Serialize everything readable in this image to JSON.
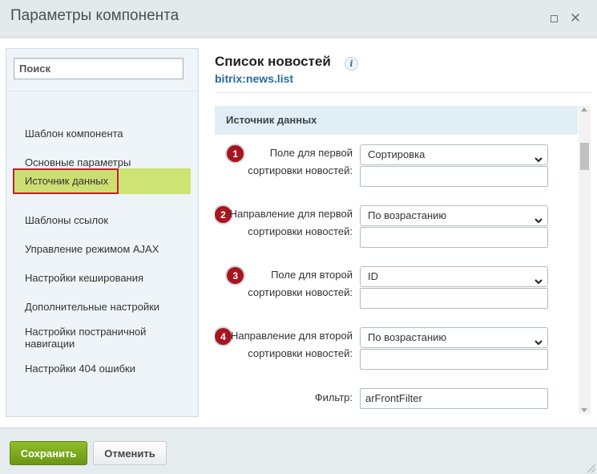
{
  "window": {
    "title": "Параметры компонента",
    "maximize_icon": "maximize-icon",
    "close_icon": "close-icon",
    "close_glyph": "✕"
  },
  "sidebar": {
    "search_placeholder": "Поиск",
    "items": [
      {
        "label": "Шаблон компонента"
      },
      {
        "label": "Основные параметры"
      },
      {
        "label": "Источник данных",
        "active": true
      },
      {
        "label": "Шаблоны ссылок"
      },
      {
        "label": "Управление режимом AJAX"
      },
      {
        "label": "Настройки кеширования"
      },
      {
        "label": "Дополнительные настройки"
      },
      {
        "label": "Настройки постраничной навигации"
      },
      {
        "label": "Настройки 404 ошибки"
      }
    ]
  },
  "main": {
    "title": "Список новостей",
    "info_glyph": "i",
    "subtitle": "bitrix:news.list",
    "section": "Источник данных",
    "fields": [
      {
        "badge": "1",
        "label_line1": "Поле для первой",
        "label_line2": "сортировки новостей:",
        "value": "Сортировка"
      },
      {
        "badge": "2",
        "label_line1": "Направление для первой",
        "label_line2": "сортировки новостей:",
        "value": "По возрастанию"
      },
      {
        "badge": "3",
        "label_line1": "Поле для второй",
        "label_line2": "сортировки новостей:",
        "value": "ID"
      },
      {
        "badge": "4",
        "label_line1": "Направление для второй",
        "label_line2": "сортировки новостей:",
        "value": "По возрастанию"
      }
    ],
    "filter": {
      "label": "Фильтр:",
      "value": "arFrontFilter"
    }
  },
  "footer": {
    "save": "Сохранить",
    "cancel": "Отменить"
  },
  "colors": {
    "accent_green": "#7aa81c",
    "badge_red": "#a8151f",
    "link_blue": "#266a9e",
    "active_item": "#cde374"
  }
}
